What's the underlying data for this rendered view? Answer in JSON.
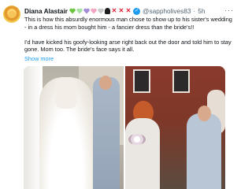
{
  "post": {
    "author_name": "Diana Alastair",
    "handle": "@sappholives83",
    "separator": "·",
    "time": "5h",
    "more_label": "···",
    "paragraphs": [
      "This is how this absurdly enormous man chose to show up to his sister's wedding - in a dress his mom bought him - a fancier dress than the bride's!!",
      "I'd have kicked his goofy-looking arse right back out the door and told him to stay gone. Mom too. The bride's face says it all."
    ],
    "show_more_label": "Show more",
    "name_emojis": [
      "green-heart",
      "light-green-heart",
      "purple-heart",
      "pink-heart",
      "grey-heart",
      "skull",
      "cross-mark",
      "cross-mark",
      "cross-mark"
    ],
    "images": [
      {
        "name": "wedding-photo-1"
      },
      {
        "name": "wedding-photo-2"
      }
    ]
  },
  "colors": {
    "text": "#0f1419",
    "secondary": "#536471",
    "link": "#1d9bf0",
    "verified": "#1d9bf0"
  }
}
